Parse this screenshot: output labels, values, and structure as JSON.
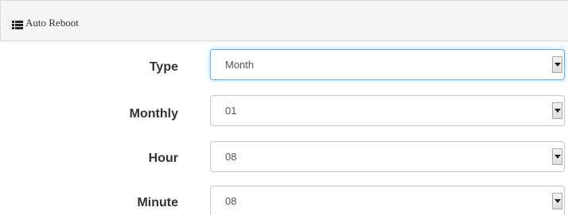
{
  "panel": {
    "title": "Auto Reboot",
    "icon": "list-icon"
  },
  "fields": {
    "type": {
      "label": "Type",
      "value": "Month"
    },
    "monthly": {
      "label": "Monthly",
      "value": "01"
    },
    "hour": {
      "label": "Hour",
      "value": "08"
    },
    "minute": {
      "label": "Minute",
      "value": "08"
    }
  },
  "colors": {
    "focus_border": "#66afe9",
    "header_background": "#f5f5f5"
  }
}
